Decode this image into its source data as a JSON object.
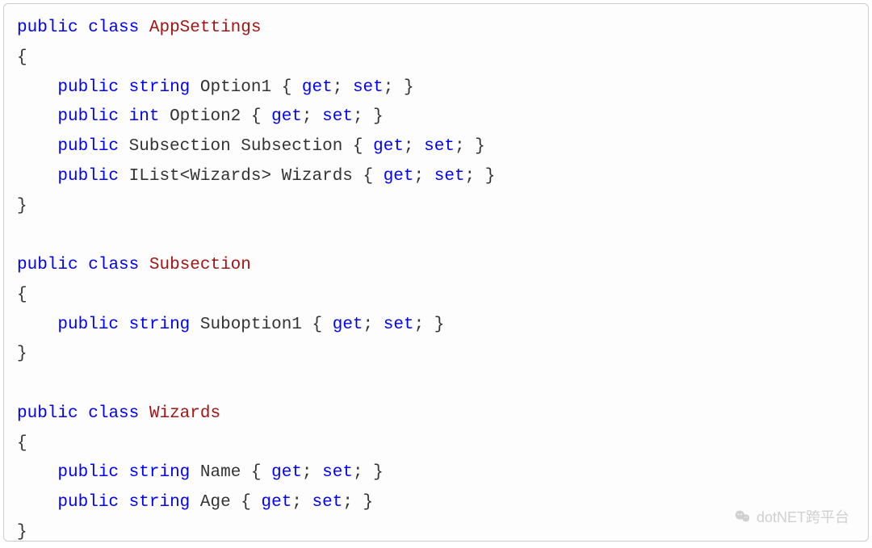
{
  "code": {
    "lines": [
      [
        {
          "t": "public",
          "c": "kw-blue"
        },
        {
          "t": " "
        },
        {
          "t": "class",
          "c": "kw-blue"
        },
        {
          "t": " "
        },
        {
          "t": "AppSettings",
          "c": "type-name"
        }
      ],
      [
        {
          "t": "{",
          "c": "brace"
        }
      ],
      [
        {
          "t": "    "
        },
        {
          "t": "public",
          "c": "kw-blue"
        },
        {
          "t": " "
        },
        {
          "t": "string",
          "c": "kw-blue"
        },
        {
          "t": " Option1 { "
        },
        {
          "t": "get",
          "c": "kw-blue"
        },
        {
          "t": "; "
        },
        {
          "t": "set",
          "c": "kw-blue"
        },
        {
          "t": "; }"
        }
      ],
      [
        {
          "t": "    "
        },
        {
          "t": "public",
          "c": "kw-blue"
        },
        {
          "t": " "
        },
        {
          "t": "int",
          "c": "kw-blue"
        },
        {
          "t": " Option2 { "
        },
        {
          "t": "get",
          "c": "kw-blue"
        },
        {
          "t": "; "
        },
        {
          "t": "set",
          "c": "kw-blue"
        },
        {
          "t": "; }"
        }
      ],
      [
        {
          "t": "    "
        },
        {
          "t": "public",
          "c": "kw-blue"
        },
        {
          "t": " Subsection Subsection { "
        },
        {
          "t": "get",
          "c": "kw-blue"
        },
        {
          "t": "; "
        },
        {
          "t": "set",
          "c": "kw-blue"
        },
        {
          "t": "; }"
        }
      ],
      [
        {
          "t": "    "
        },
        {
          "t": "public",
          "c": "kw-blue"
        },
        {
          "t": " IList<Wizards> Wizards { "
        },
        {
          "t": "get",
          "c": "kw-blue"
        },
        {
          "t": "; "
        },
        {
          "t": "set",
          "c": "kw-blue"
        },
        {
          "t": "; }"
        }
      ],
      [
        {
          "t": "}",
          "c": "brace"
        }
      ],
      [
        {
          "t": ""
        }
      ],
      [
        {
          "t": "public",
          "c": "kw-blue"
        },
        {
          "t": " "
        },
        {
          "t": "class",
          "c": "kw-blue"
        },
        {
          "t": " "
        },
        {
          "t": "Subsection",
          "c": "type-name"
        }
      ],
      [
        {
          "t": "{",
          "c": "brace"
        }
      ],
      [
        {
          "t": "    "
        },
        {
          "t": "public",
          "c": "kw-blue"
        },
        {
          "t": " "
        },
        {
          "t": "string",
          "c": "kw-blue"
        },
        {
          "t": " Suboption1 { "
        },
        {
          "t": "get",
          "c": "kw-blue"
        },
        {
          "t": "; "
        },
        {
          "t": "set",
          "c": "kw-blue"
        },
        {
          "t": "; }"
        }
      ],
      [
        {
          "t": "}",
          "c": "brace"
        }
      ],
      [
        {
          "t": ""
        }
      ],
      [
        {
          "t": "public",
          "c": "kw-blue"
        },
        {
          "t": " "
        },
        {
          "t": "class",
          "c": "kw-blue"
        },
        {
          "t": " "
        },
        {
          "t": "Wizards",
          "c": "type-name"
        }
      ],
      [
        {
          "t": "{",
          "c": "brace"
        }
      ],
      [
        {
          "t": "    "
        },
        {
          "t": "public",
          "c": "kw-blue"
        },
        {
          "t": " "
        },
        {
          "t": "string",
          "c": "kw-blue"
        },
        {
          "t": " Name { "
        },
        {
          "t": "get",
          "c": "kw-blue"
        },
        {
          "t": "; "
        },
        {
          "t": "set",
          "c": "kw-blue"
        },
        {
          "t": "; }"
        }
      ],
      [
        {
          "t": "    "
        },
        {
          "t": "public",
          "c": "kw-blue"
        },
        {
          "t": " "
        },
        {
          "t": "string",
          "c": "kw-blue"
        },
        {
          "t": " Age { "
        },
        {
          "t": "get",
          "c": "kw-blue"
        },
        {
          "t": "; "
        },
        {
          "t": "set",
          "c": "kw-blue"
        },
        {
          "t": "; }"
        }
      ],
      [
        {
          "t": "}",
          "c": "brace"
        }
      ]
    ]
  },
  "watermark": {
    "text": "dotNET跨平台"
  }
}
